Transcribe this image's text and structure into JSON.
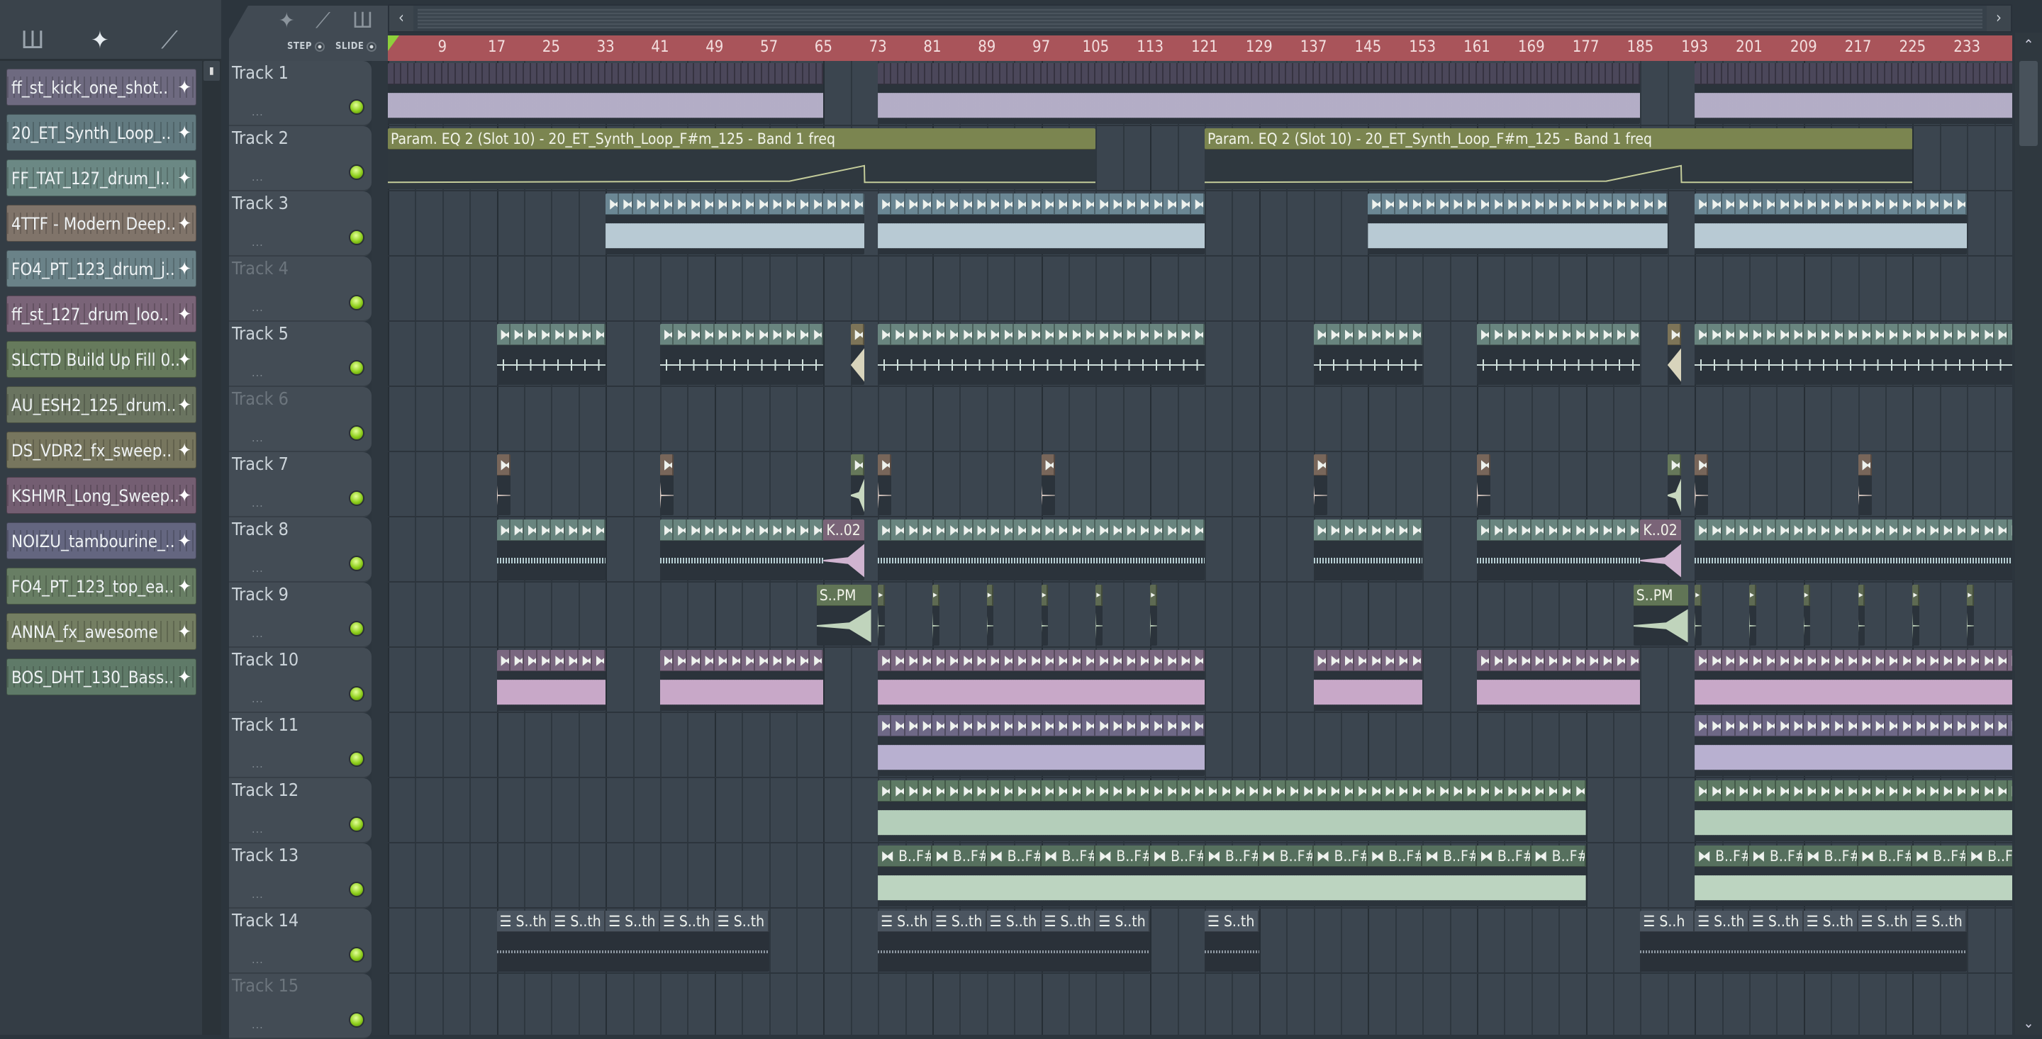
{
  "sidebar": {
    "tools": [
      {
        "icon": "piano-roll-icon",
        "glyph": "Ш"
      },
      {
        "icon": "audio-clip-icon",
        "glyph": "✦"
      },
      {
        "icon": "automation-icon",
        "glyph": "⟋"
      }
    ],
    "items": [
      {
        "label": "ff_st_kick_one_shot..",
        "color": "#6e6a80"
      },
      {
        "label": "20_ET_Synth_Loop_..",
        "color": "#627a80"
      },
      {
        "label": "FF_TAT_127_drum_l..",
        "color": "#6b8884"
      },
      {
        "label": "4TTF - Modern Deep..",
        "color": "#80746a"
      },
      {
        "label": "FO4_PT_123_drum_j..",
        "color": "#6a8288"
      },
      {
        "label": "ff_st_127_drum_loo..",
        "color": "#7a6478"
      },
      {
        "label": "SLCTD Build Up Fill 0..",
        "color": "#667a5c"
      },
      {
        "label": "AU_ESH2_125_drum..",
        "color": "#6a7460"
      },
      {
        "label": "DS_VDR2_fx_sweep..",
        "color": "#77765e"
      },
      {
        "label": "KSHMR_Long_Sweep..",
        "color": "#745e72"
      },
      {
        "label": "NOIZU_tambourine_..",
        "color": "#646680"
      },
      {
        "label": "FO4_PT_123_top_ea..",
        "color": "#687e64"
      },
      {
        "label": "ANNA_fx_awesome",
        "color": "#747e62"
      },
      {
        "label": "BOS_DHT_130_Bass..",
        "color": "#5f7a68"
      }
    ]
  },
  "toolbar": {
    "step_label": "STEP",
    "slide_label": "SLIDE",
    "left_arrow": "‹",
    "right_arrow": "›"
  },
  "ruler": {
    "labels": [
      "9",
      "17",
      "25",
      "33",
      "41",
      "49",
      "57",
      "65",
      "73",
      "81",
      "89",
      "97",
      "105",
      "113",
      "121",
      "129",
      "137",
      "145",
      "153",
      "161",
      "169",
      "177",
      "185",
      "193",
      "201",
      "209",
      "217",
      "225",
      "233"
    ]
  },
  "tracks": [
    {
      "name": "Track 1",
      "dim": false,
      "more": "...",
      "clips": [
        {
          "s": 1,
          "e": 65,
          "hd": "#4b475a",
          "wave": "#b3adc6",
          "style": "dense",
          "seg": 1
        },
        {
          "s": 73,
          "e": 185,
          "hd": "#4b475a",
          "wave": "#b3adc6",
          "style": "dense",
          "seg": 1
        },
        {
          "s": 193,
          "e": 241,
          "hd": "#4b475a",
          "wave": "#b3adc6",
          "style": "dense",
          "seg": 1
        }
      ]
    },
    {
      "name": "Track 2",
      "dim": false,
      "more": "...",
      "clips": [
        {
          "s": 1,
          "e": 105,
          "hd": "#7b8550",
          "style": "auto",
          "label": "Param. EQ 2 (Slot 10) - 20_ET_Synth_Loop_F#m_125 - Band 1 freq",
          "points": [
            [
              1,
              0.15
            ],
            [
              60,
              0.18
            ],
            [
              71,
              0.6
            ],
            [
              71.05,
              0.15
            ],
            [
              105,
              0.15
            ]
          ]
        },
        {
          "s": 121,
          "e": 225,
          "hd": "#7b8550",
          "style": "auto",
          "label": "Param. EQ 2 (Slot 10) - 20_ET_Synth_Loop_F#m_125 - Band 1 freq",
          "points": [
            [
              121,
              0.15
            ],
            [
              180,
              0.18
            ],
            [
              191,
              0.6
            ],
            [
              191.05,
              0.15
            ],
            [
              225,
              0.15
            ]
          ]
        }
      ]
    },
    {
      "name": "Track 3",
      "dim": false,
      "more": "...",
      "clips": [
        {
          "s": 33,
          "e": 71,
          "hd": "#6b8794",
          "wave": "#b8cad4",
          "style": "dense",
          "seg": 2,
          "icon": "⧓"
        },
        {
          "s": 73,
          "e": 121,
          "hd": "#6b8794",
          "wave": "#b8cad4",
          "style": "dense",
          "seg": 2,
          "icon": "⧓"
        },
        {
          "s": 145,
          "e": 189,
          "hd": "#6b8794",
          "wave": "#b8cad4",
          "style": "dense",
          "seg": 2,
          "icon": "⧓"
        },
        {
          "s": 193,
          "e": 233,
          "hd": "#6b8794",
          "wave": "#b8cad4",
          "style": "dense",
          "seg": 2,
          "icon": "⧓"
        }
      ]
    },
    {
      "name": "Track 4",
      "dim": true,
      "more": "...",
      "clips": []
    },
    {
      "name": "Track 5",
      "dim": false,
      "more": "...",
      "clips": [
        {
          "s": 17,
          "e": 33,
          "hd": "#69857f",
          "wave": "#d0e0dc",
          "style": "ticks",
          "seg": 2,
          "icon": "⧓"
        },
        {
          "s": 41,
          "e": 65,
          "hd": "#69857f",
          "wave": "#d0e0dc",
          "style": "ticks",
          "seg": 2,
          "icon": "⧓"
        },
        {
          "s": 69,
          "e": 71,
          "hd": "#7d7458",
          "wave": "#d8d4bc",
          "style": "rev",
          "seg": 2,
          "icon": "⧓"
        },
        {
          "s": 73,
          "e": 121,
          "hd": "#69857f",
          "wave": "#d0e0dc",
          "style": "ticks",
          "seg": 2,
          "icon": "⧓"
        },
        {
          "s": 137,
          "e": 153,
          "hd": "#69857f",
          "wave": "#d0e0dc",
          "style": "ticks",
          "seg": 2,
          "icon": "⧓"
        },
        {
          "s": 161,
          "e": 185,
          "hd": "#69857f",
          "wave": "#d0e0dc",
          "style": "ticks",
          "seg": 2,
          "icon": "⧓"
        },
        {
          "s": 189,
          "e": 191,
          "hd": "#7d7458",
          "wave": "#d8d4bc",
          "style": "rev",
          "seg": 2,
          "icon": "⧓"
        },
        {
          "s": 193,
          "e": 241,
          "hd": "#69857f",
          "wave": "#d0e0dc",
          "style": "ticks",
          "seg": 2,
          "icon": "⧓"
        }
      ]
    },
    {
      "name": "Track 6",
      "dim": true,
      "more": "...",
      "clips": []
    },
    {
      "name": "Track 7",
      "dim": false,
      "more": "...",
      "clips": [
        {
          "s": 17,
          "e": 19,
          "hd": "#78665a",
          "wave": "#d8c8c0",
          "style": "hit",
          "seg": 2,
          "icon": "⧓"
        },
        {
          "s": 41,
          "e": 43,
          "hd": "#78665a",
          "wave": "#d8c8c0",
          "style": "hit",
          "seg": 2,
          "icon": "⧓"
        },
        {
          "s": 69,
          "e": 71,
          "hd": "#66785a",
          "wave": "#c8d8c0",
          "style": "swell",
          "seg": 2,
          "icon": "⧓"
        },
        {
          "s": 73,
          "e": 75,
          "hd": "#78665a",
          "wave": "#d8c8c0",
          "style": "hit",
          "seg": 2,
          "icon": "⧓"
        },
        {
          "s": 97,
          "e": 99,
          "hd": "#78665a",
          "wave": "#d8c8c0",
          "style": "hit",
          "seg": 2,
          "icon": "⧓"
        },
        {
          "s": 137,
          "e": 139,
          "hd": "#78665a",
          "wave": "#d8c8c0",
          "style": "hit",
          "seg": 2,
          "icon": "⧓"
        },
        {
          "s": 161,
          "e": 163,
          "hd": "#78665a",
          "wave": "#d8c8c0",
          "style": "hit",
          "seg": 2,
          "icon": "⧓"
        },
        {
          "s": 189,
          "e": 191,
          "hd": "#66785a",
          "wave": "#c8d8c0",
          "style": "swell",
          "seg": 2,
          "icon": "⧓"
        },
        {
          "s": 193,
          "e": 195,
          "hd": "#78665a",
          "wave": "#d8c8c0",
          "style": "hit",
          "seg": 2,
          "icon": "⧓"
        },
        {
          "s": 217,
          "e": 219,
          "hd": "#78665a",
          "wave": "#d8c8c0",
          "style": "hit",
          "seg": 2,
          "icon": "⧓"
        }
      ]
    },
    {
      "name": "Track 8",
      "dim": false,
      "more": "...",
      "clips": [
        {
          "s": 17,
          "e": 33,
          "hd": "#69857f",
          "wave": "#b8d0d4",
          "style": "thin",
          "seg": 2,
          "icon": "⧓"
        },
        {
          "s": 41,
          "e": 65,
          "hd": "#69857f",
          "wave": "#b8d0d4",
          "style": "thin",
          "seg": 2,
          "icon": "⧓"
        },
        {
          "s": 65,
          "e": 71,
          "hd": "#7a6478",
          "wave": "#d0b4d0",
          "style": "swell",
          "label": "K..02"
        },
        {
          "s": 73,
          "e": 121,
          "hd": "#69857f",
          "wave": "#b8d0d4",
          "style": "thin",
          "seg": 2,
          "icon": "⧓"
        },
        {
          "s": 137,
          "e": 153,
          "hd": "#69857f",
          "wave": "#b8d0d4",
          "style": "thin",
          "seg": 2,
          "icon": "⧓"
        },
        {
          "s": 161,
          "e": 185,
          "hd": "#69857f",
          "wave": "#b8d0d4",
          "style": "thin",
          "seg": 2,
          "icon": "⧓"
        },
        {
          "s": 185,
          "e": 191,
          "hd": "#7a6478",
          "wave": "#d0b4d0",
          "style": "swell",
          "label": "K..02"
        },
        {
          "s": 193,
          "e": 241,
          "hd": "#69857f",
          "wave": "#b8d0d4",
          "style": "thin",
          "seg": 2,
          "icon": "⧓"
        }
      ]
    },
    {
      "name": "Track 9",
      "dim": false,
      "more": "...",
      "clips": [
        {
          "s": 64,
          "e": 72,
          "hd": "#617556",
          "wave": "#c0d4bc",
          "style": "swell",
          "label": "S..PM"
        },
        {
          "s": 73,
          "e": 74,
          "hd": "#5e6a52",
          "wave": "#c0d4bc",
          "style": "hit",
          "seg": 1,
          "icon": "▸"
        },
        {
          "s": 81,
          "e": 82,
          "hd": "#5e6a52",
          "wave": "#c0d4bc",
          "style": "hit",
          "seg": 1,
          "icon": "▸"
        },
        {
          "s": 89,
          "e": 90,
          "hd": "#5e6a52",
          "wave": "#c0d4bc",
          "style": "hit",
          "seg": 1,
          "icon": "▸"
        },
        {
          "s": 97,
          "e": 98,
          "hd": "#5e6a52",
          "wave": "#c0d4bc",
          "style": "hit",
          "seg": 1,
          "icon": "▸"
        },
        {
          "s": 105,
          "e": 106,
          "hd": "#5e6a52",
          "wave": "#c0d4bc",
          "style": "hit",
          "seg": 1,
          "icon": "▸"
        },
        {
          "s": 113,
          "e": 114,
          "hd": "#5e6a52",
          "wave": "#c0d4bc",
          "style": "hit",
          "seg": 1,
          "icon": "▸"
        },
        {
          "s": 184,
          "e": 192,
          "hd": "#617556",
          "wave": "#c0d4bc",
          "style": "swell",
          "label": "S..PM"
        },
        {
          "s": 193,
          "e": 194,
          "hd": "#5e6a52",
          "wave": "#c0d4bc",
          "style": "hit",
          "seg": 1,
          "icon": "▸"
        },
        {
          "s": 201,
          "e": 202,
          "hd": "#5e6a52",
          "wave": "#c0d4bc",
          "style": "hit",
          "seg": 1,
          "icon": "▸"
        },
        {
          "s": 209,
          "e": 210,
          "hd": "#5e6a52",
          "wave": "#c0d4bc",
          "style": "hit",
          "seg": 1,
          "icon": "▸"
        },
        {
          "s": 217,
          "e": 218,
          "hd": "#5e6a52",
          "wave": "#c0d4bc",
          "style": "hit",
          "seg": 1,
          "icon": "▸"
        },
        {
          "s": 225,
          "e": 226,
          "hd": "#5e6a52",
          "wave": "#c0d4bc",
          "style": "hit",
          "seg": 1,
          "icon": "▸"
        },
        {
          "s": 233,
          "e": 234,
          "hd": "#5e6a52",
          "wave": "#c0d4bc",
          "style": "hit",
          "seg": 1,
          "icon": "▸"
        }
      ]
    },
    {
      "name": "Track 10",
      "dim": false,
      "more": "...",
      "clips": [
        {
          "s": 17,
          "e": 33,
          "hd": "#7a6780",
          "wave": "#c8a8c8",
          "style": "dense",
          "seg": 2,
          "icon": "⧓"
        },
        {
          "s": 41,
          "e": 65,
          "hd": "#7a6780",
          "wave": "#c8a8c8",
          "style": "dense",
          "seg": 2,
          "icon": "⧓"
        },
        {
          "s": 73,
          "e": 121,
          "hd": "#7a6780",
          "wave": "#c8a8c8",
          "style": "dense",
          "seg": 2,
          "icon": "⧓"
        },
        {
          "s": 137,
          "e": 153,
          "hd": "#7a6780",
          "wave": "#c8a8c8",
          "style": "dense",
          "seg": 2,
          "icon": "⧓"
        },
        {
          "s": 161,
          "e": 185,
          "hd": "#7a6780",
          "wave": "#c8a8c8",
          "style": "dense",
          "seg": 2,
          "icon": "⧓"
        },
        {
          "s": 193,
          "e": 241,
          "hd": "#7a6780",
          "wave": "#c8a8c8",
          "style": "dense",
          "seg": 2,
          "icon": "⧓"
        }
      ]
    },
    {
      "name": "Track 11",
      "dim": false,
      "more": "...",
      "clips": [
        {
          "s": 73,
          "e": 121,
          "hd": "#6e6886",
          "wave": "#b8b0d0",
          "style": "dense",
          "seg": 2,
          "icon": "⧓"
        },
        {
          "s": 193,
          "e": 241,
          "hd": "#6e6886",
          "wave": "#b8b0d0",
          "style": "dense",
          "seg": 2,
          "icon": "⧓"
        }
      ]
    },
    {
      "name": "Track 12",
      "dim": false,
      "more": "...",
      "clips": [
        {
          "s": 73,
          "e": 177,
          "hd": "#5e7a64",
          "wave": "#b4ceba",
          "style": "dense",
          "seg": 2,
          "icon": "⧓"
        },
        {
          "s": 193,
          "e": 241,
          "hd": "#5e7a64",
          "wave": "#b4ceba",
          "style": "dense",
          "seg": 2,
          "icon": "⧓"
        }
      ]
    },
    {
      "name": "Track 13",
      "dim": false,
      "more": "...",
      "clips": [
        {
          "s": 73,
          "e": 177,
          "hd": "#56705e",
          "wave": "#bcd4c0",
          "style": "dense",
          "seg": 8,
          "icon": "⧓ B..F#"
        },
        {
          "s": 193,
          "e": 241,
          "hd": "#56705e",
          "wave": "#bcd4c0",
          "style": "dense",
          "seg": 8,
          "icon": "⧓ B..F#"
        }
      ]
    },
    {
      "name": "Track 14",
      "dim": false,
      "more": "...",
      "clips": [
        {
          "s": 17,
          "e": 57,
          "hd": "#4b5560",
          "wave": "#8e98a2",
          "style": "dots",
          "seg": 8,
          "icon": "☰ S..th"
        },
        {
          "s": 73,
          "e": 113,
          "hd": "#4b5560",
          "wave": "#8e98a2",
          "style": "dots",
          "seg": 8,
          "icon": "☰ S..th"
        },
        {
          "s": 121,
          "e": 129,
          "hd": "#4b5560",
          "wave": "#8e98a2",
          "style": "dots",
          "seg": 8,
          "icon": "☰ S..th"
        },
        {
          "s": 185,
          "e": 193,
          "hd": "#4b5560",
          "wave": "#8e98a2",
          "style": "dots",
          "seg": 8,
          "icon": "☰ S..h"
        },
        {
          "s": 193,
          "e": 233,
          "hd": "#4b5560",
          "wave": "#8e98a2",
          "style": "dots",
          "seg": 8,
          "icon": "☰ S..th"
        }
      ]
    },
    {
      "name": "Track 15",
      "dim": true,
      "more": "...",
      "clips": []
    }
  ]
}
